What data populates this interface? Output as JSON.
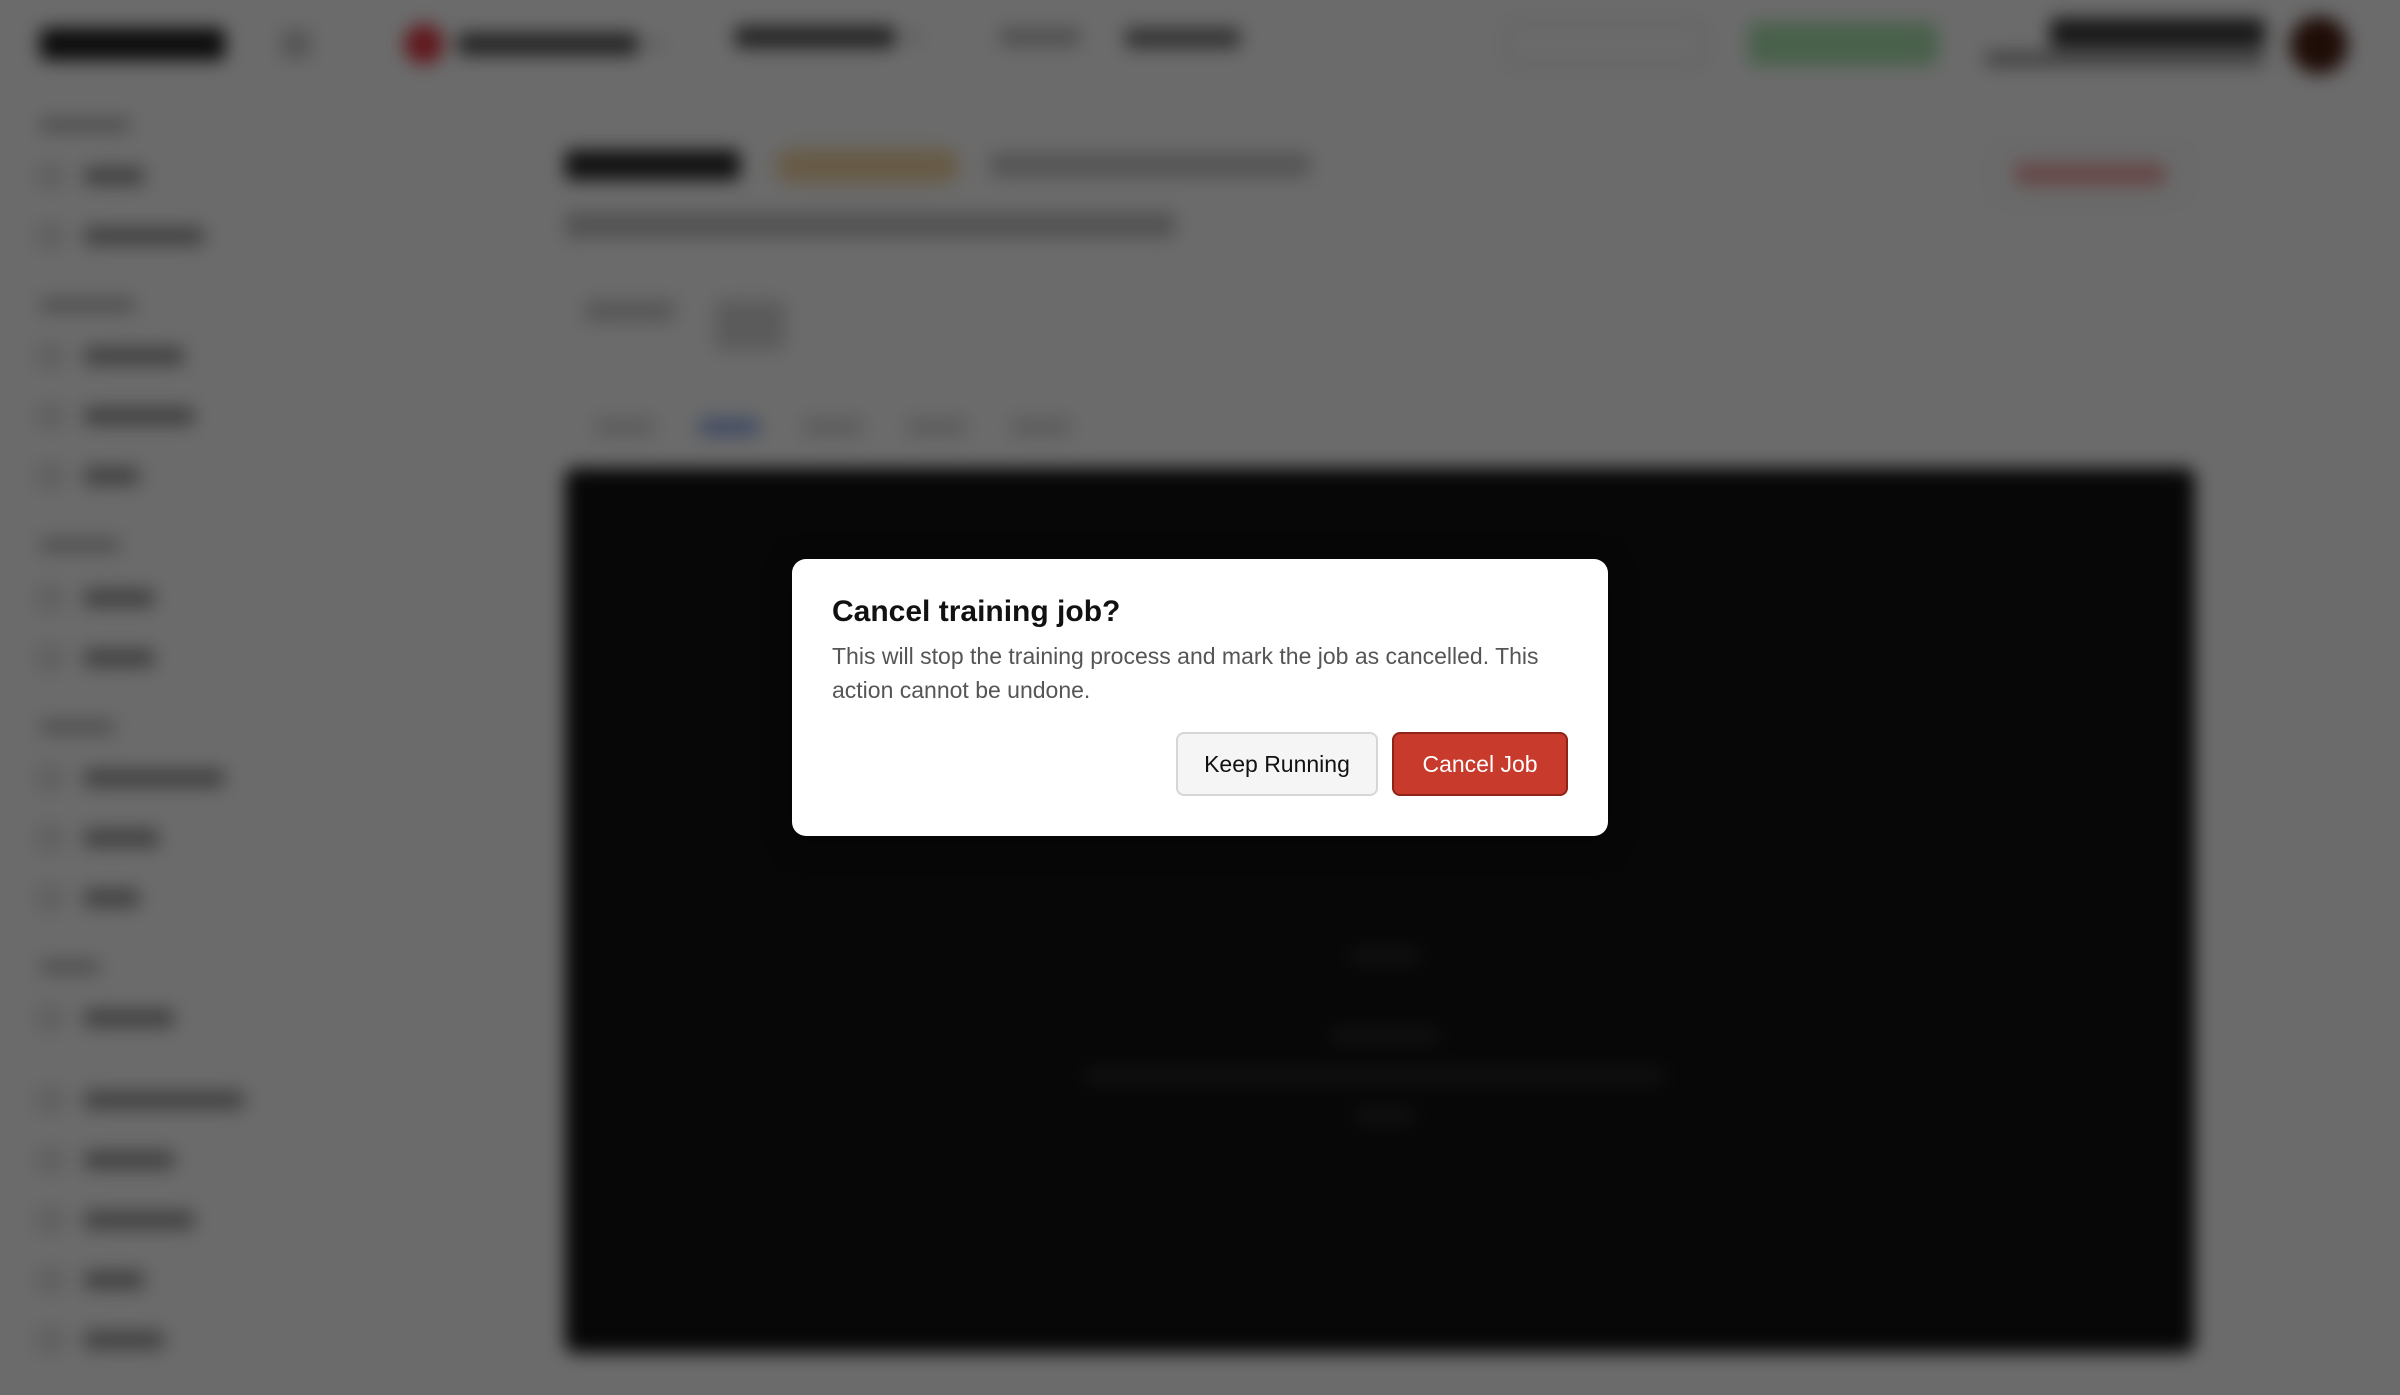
{
  "dialog": {
    "title": "Cancel training job?",
    "body": "This will stop the training process and mark the job as cancelled. This action cannot be undone.",
    "keep_label": "Keep Running",
    "cancel_label": "Cancel Job"
  },
  "colors": {
    "danger": "#c83a2c",
    "overlay": "rgba(0,0,0,0.58)"
  }
}
